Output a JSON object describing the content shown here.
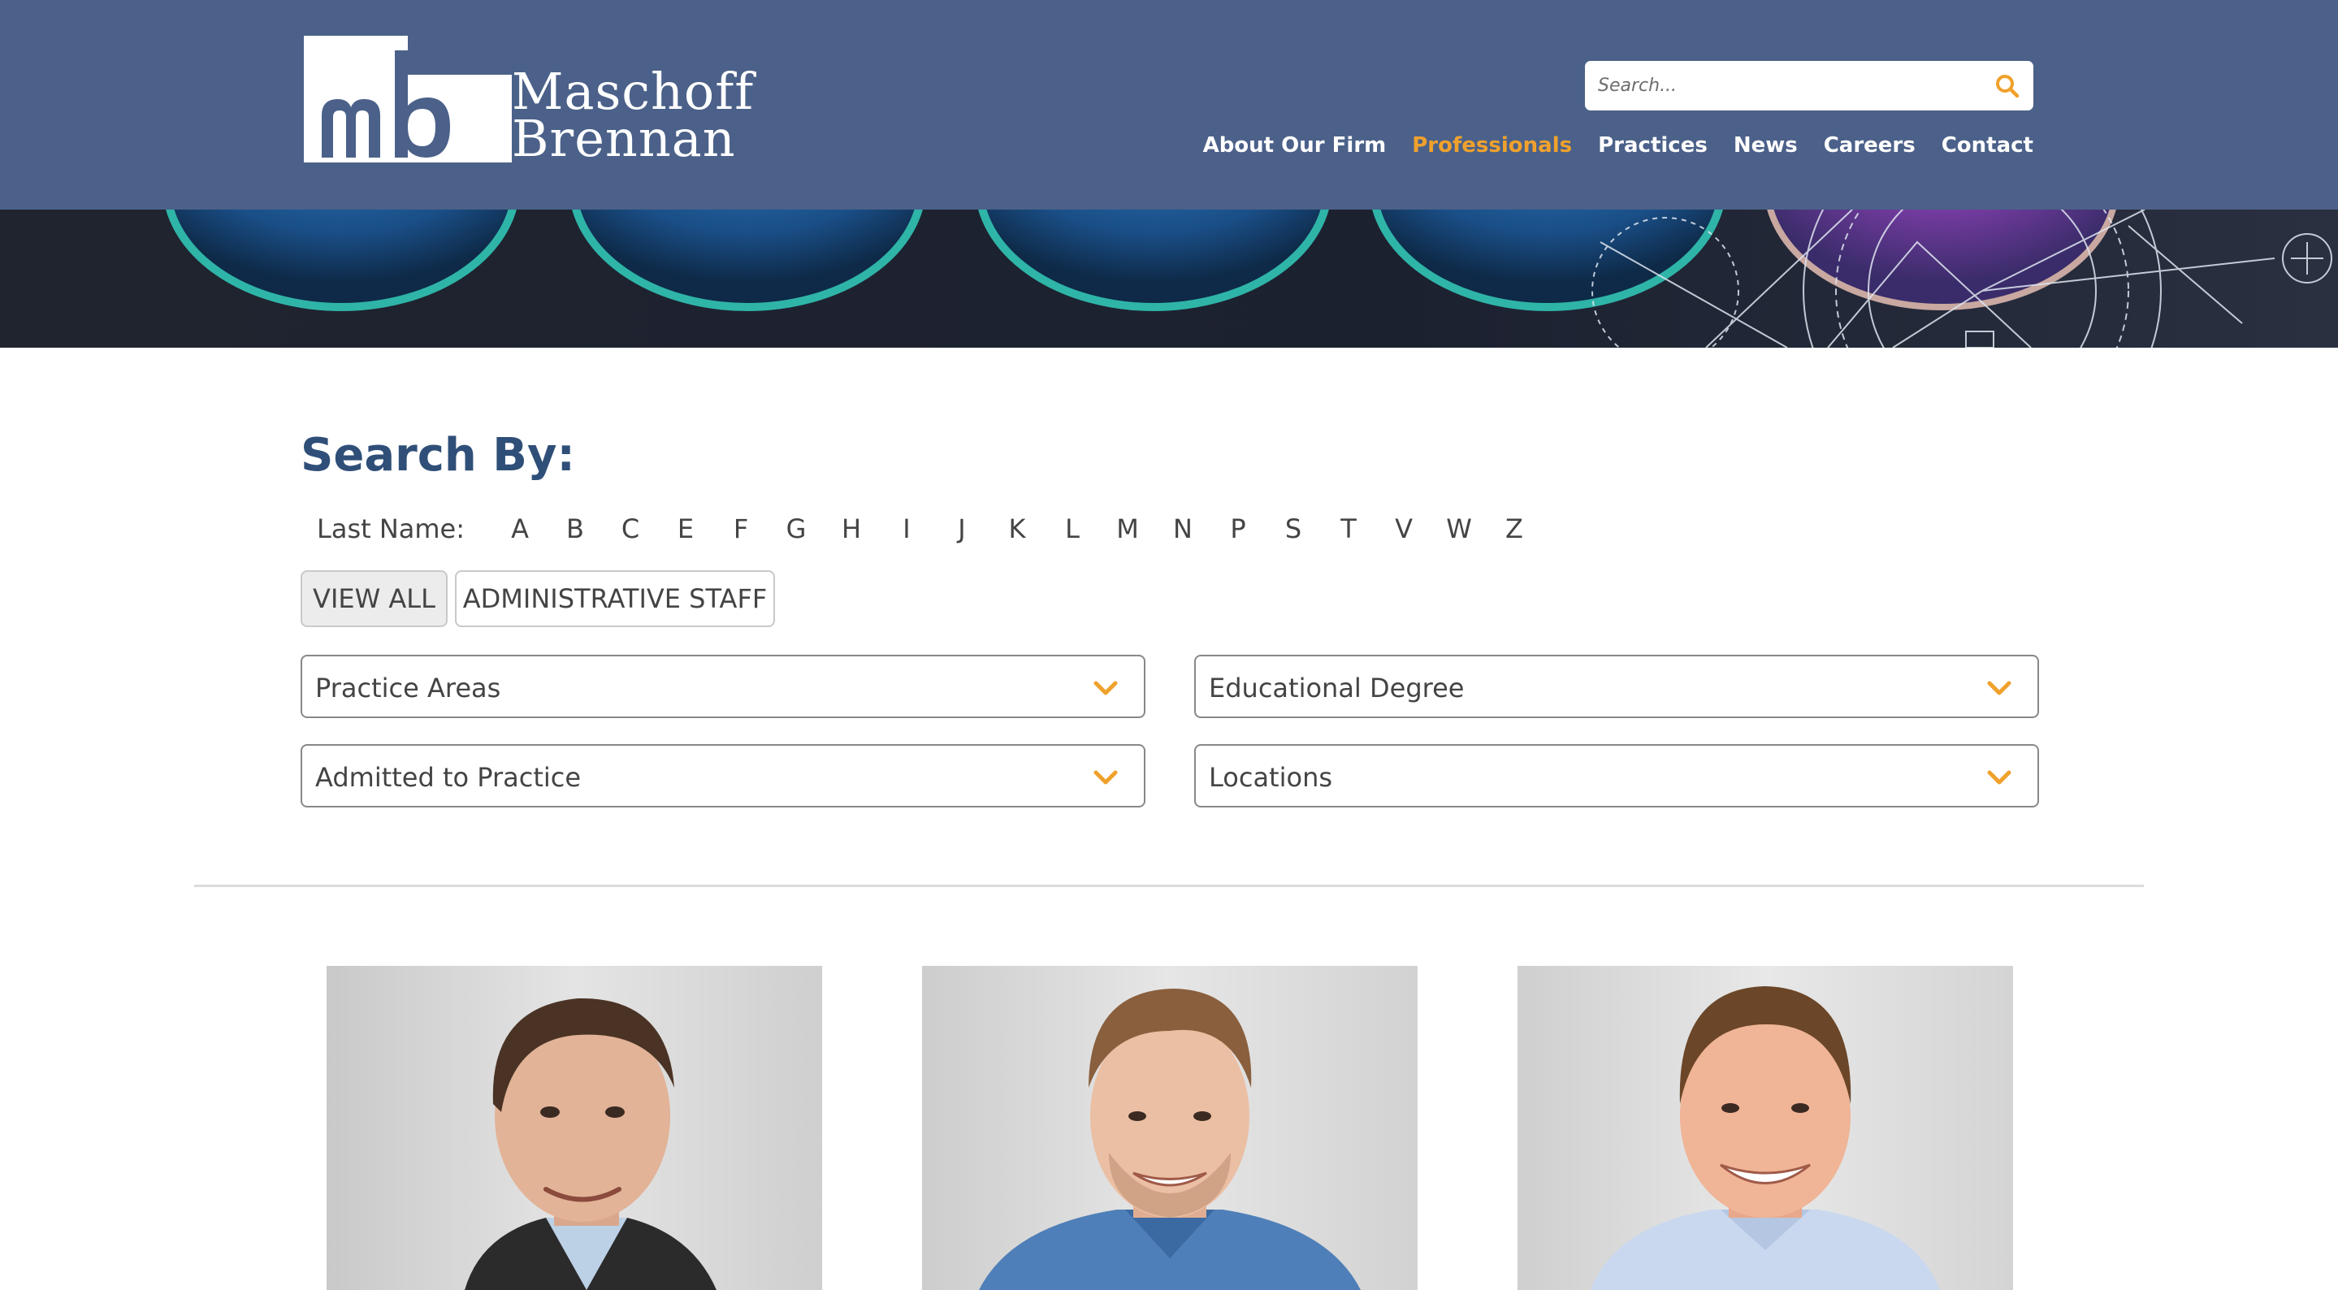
{
  "header": {
    "logo": {
      "mark": "mb",
      "line1": "Maschoff",
      "line2": "Brennan"
    },
    "search": {
      "placeholder": "Search..."
    },
    "nav": [
      {
        "label": "About Our Firm",
        "active": false
      },
      {
        "label": "Professionals",
        "active": true
      },
      {
        "label": "Practices",
        "active": false
      },
      {
        "label": "News",
        "active": false
      },
      {
        "label": "Careers",
        "active": false
      },
      {
        "label": "Contact",
        "active": false
      }
    ]
  },
  "filters": {
    "title": "Search By:",
    "last_name_label": "Last Name:",
    "letters": [
      "A",
      "B",
      "C",
      "E",
      "F",
      "G",
      "H",
      "I",
      "J",
      "K",
      "L",
      "M",
      "N",
      "P",
      "S",
      "T",
      "V",
      "W",
      "Z"
    ],
    "view_all": "VIEW ALL",
    "admin_staff": "ADMINISTRATIVE STAFF",
    "selects": {
      "practice_areas": "Practice Areas",
      "educational_degree": "Educational Degree",
      "admitted": "Admitted to Practice",
      "locations": "Locations"
    }
  },
  "colors": {
    "header_bg": "#4b6189",
    "accent": "#f0a12c",
    "title": "#2f4f78"
  }
}
